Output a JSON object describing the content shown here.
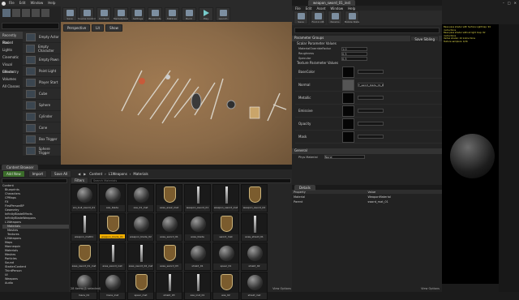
{
  "editor": {
    "tab_title": "UE4 Editor",
    "menu": [
      "File",
      "Edit",
      "Window",
      "Help"
    ],
    "toolbar": [
      "Save",
      "Source Control",
      "Content",
      "Marketplace",
      "Settings",
      "Blueprints",
      "Matinee",
      "Build",
      "Play",
      "Launch"
    ],
    "viewport_menu": [
      "Perspective",
      "Lit",
      "Show"
    ],
    "modes_header": "Recently Placed",
    "modes_categories": [
      "Basic",
      "Lights",
      "Cinematic",
      "Visual Effects",
      "Geometry",
      "Volumes",
      "All Classes"
    ],
    "placeables": [
      "Empty Actor",
      "Empty Character",
      "Empty Pawn",
      "Point Light",
      "Player Start",
      "Cube",
      "Sphere",
      "Cylinder",
      "Cone",
      "Box Trigger",
      "Sphere Trigger"
    ],
    "content_browser": {
      "tab": "Content Browser",
      "add_new": "Add New",
      "import": "Import",
      "save_all": "Save All",
      "path": [
        "Content",
        "L1Weapons",
        "Materials"
      ],
      "filters": "Filters",
      "search_placeholder": "Search Materials",
      "tree": [
        "Content",
        "Blueprints",
        "Characters",
        "CPMaps",
        "FX",
        "FirstPersonBP",
        "Geometry",
        "InfinityBladeEffects",
        "InfinityBladeWeapons",
        "L1Weapons",
        "Materials",
        "Meshes",
        "Textures",
        "L2Weapons",
        "Maps",
        "Mannequin",
        "Materials",
        "Meshes",
        "Particles",
        "Sound",
        "StarterContent",
        "ThirdPerson",
        "UI",
        "Weapons",
        "Audio"
      ],
      "assets": [
        "ani_bull_sword_01",
        "axe_blade",
        "axe_01_inst",
        "axes_axe2_mat",
        "weapon_sword_01",
        "weapon_sword_inst",
        "weapon_sword_02",
        "weapon_mat01",
        "weapon_blade_01",
        "weapon_blade_02",
        "axes_sword_01",
        "axes_blade",
        "sword_mat",
        "axes_shield_01",
        "axes_sword_01_inst",
        "axes_sword_inst",
        "axes_sword_02_inst",
        "axes_sword_03",
        "shield_01",
        "spear_01",
        "shield_02",
        "mace_01",
        "mace_inst",
        "spear_mat",
        "shield_03",
        "axe_inst_01",
        "axe_02",
        "shield_inst"
      ],
      "selected_index": 8,
      "status": "28 items (1 selected)",
      "view_options": "View Options"
    },
    "material_editor": {
      "tab": "weapon_sword_01_inst",
      "menu": [
        "File",
        "Edit",
        "Asset",
        "Window",
        "Help"
      ],
      "toolbar": [
        "Save",
        "Find in CB",
        "Params",
        "Mobile Stats"
      ],
      "section": "Parameter Groups",
      "save_btn": "Save Sibling",
      "subsection": "Scalar Parameter Values",
      "scalar": [
        {
          "label": "MaterialOverrideFactor",
          "value": "1.0"
        },
        {
          "label": "Roughness",
          "value": "0.5"
        },
        {
          "label": "Specular",
          "value": "0.5"
        }
      ],
      "texture_header": "Texture Parameter Values",
      "textures": [
        "BaseColor",
        "Normal",
        "Metallic",
        "Emissive",
        "Opacity",
        "Mask"
      ],
      "texture_value": "T_sword_blade_01_D",
      "general": "General",
      "phys_material": "Phys Material",
      "none": "None"
    },
    "preview_log": [
      "Base pass shader with Surface Lightmap: 94 instructions",
      "Base pass shader without light map: 82 instructions",
      "Vertex shader: 42 instructions",
      "Texture samplers: 4/16"
    ],
    "details": {
      "tab": "Details",
      "cols": [
        "Property",
        "Value"
      ],
      "rows": [
        [
          "Material",
          "WeaponMaterial"
        ],
        [
          "Parent",
          "sword_mat_01"
        ]
      ]
    },
    "status_right": "View Options"
  }
}
